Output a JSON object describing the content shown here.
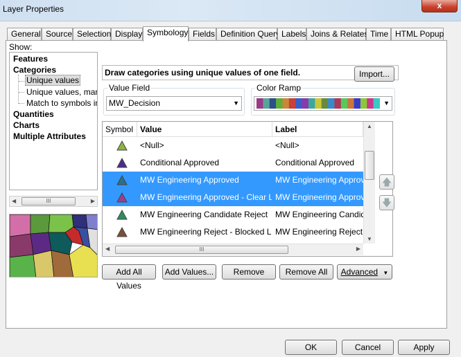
{
  "window": {
    "title": "Layer Properties",
    "close_glyph": "x"
  },
  "tabs": [
    {
      "label": "General"
    },
    {
      "label": "Source"
    },
    {
      "label": "Selection"
    },
    {
      "label": "Display"
    },
    {
      "label": "Symbology"
    },
    {
      "label": "Fields"
    },
    {
      "label": "Definition Query"
    },
    {
      "label": "Labels"
    },
    {
      "label": "Joins & Relates"
    },
    {
      "label": "Time"
    },
    {
      "label": "HTML Popup"
    }
  ],
  "active_tab": "Symbology",
  "show": {
    "label": "Show:",
    "items": [
      {
        "label": "Features"
      },
      {
        "label": "Categories"
      },
      {
        "label": "Unique values"
      },
      {
        "label": "Unique values, many"
      },
      {
        "label": "Match to symbols in a"
      },
      {
        "label": "Quantities"
      },
      {
        "label": "Charts"
      },
      {
        "label": "Multiple Attributes"
      }
    ],
    "scroll_grip": "III"
  },
  "heading": "Draw categories using unique values of one field.",
  "import_button": "Import...",
  "value_field": {
    "title": "Value Field",
    "value": "MW_Decision"
  },
  "color_ramp": {
    "title": "Color Ramp",
    "colors": [
      "#9b3a87",
      "#5aa39b",
      "#2c4f86",
      "#5fae3a",
      "#c9873a",
      "#c8403a",
      "#3a5ec8",
      "#8a3aa8",
      "#3aa8a0",
      "#c8c83a",
      "#6a8a3a",
      "#3a8ac8",
      "#a83a5a",
      "#5ac85a",
      "#c8783a",
      "#3a3ac8",
      "#8ac83a",
      "#c83a8a",
      "#3ac8c8"
    ]
  },
  "table": {
    "columns": {
      "symbol": "Symbol",
      "value": "Value",
      "label": "Label"
    },
    "rows": [
      {
        "value": "<Null>",
        "label": "<Null>",
        "color": "#8cb343",
        "selected": false
      },
      {
        "value": "Conditional Approved",
        "label": "Conditional Approved",
        "color": "#4b2c8c",
        "selected": false
      },
      {
        "value": "MW Engineering Approved",
        "label": "MW Engineering Approved",
        "color": "#2f6f86",
        "selected": true
      },
      {
        "value": "MW Engineering Approved - Clear LOS",
        "label": "MW Engineering Approved - Clear LOS",
        "color": "#9e3d91",
        "selected": true
      },
      {
        "value": "MW Engineering Candidate Reject",
        "label": "MW Engineering Candidate Reject",
        "color": "#2f8c5c",
        "selected": false
      },
      {
        "value": "MW Engineering Reject - Blocked LOS",
        "label": "MW Engineering Reject - Blocked LOS",
        "color": "#7c4f3a",
        "selected": false
      }
    ],
    "scroll_grip": "III"
  },
  "buttons": {
    "add_all": "Add All Values",
    "add_values": "Add Values...",
    "remove": "Remove",
    "remove_all": "Remove All",
    "advanced": "Advanced"
  },
  "footer": {
    "ok": "OK",
    "cancel": "Cancel",
    "apply": "Apply"
  },
  "selection_color": "#3399ff"
}
